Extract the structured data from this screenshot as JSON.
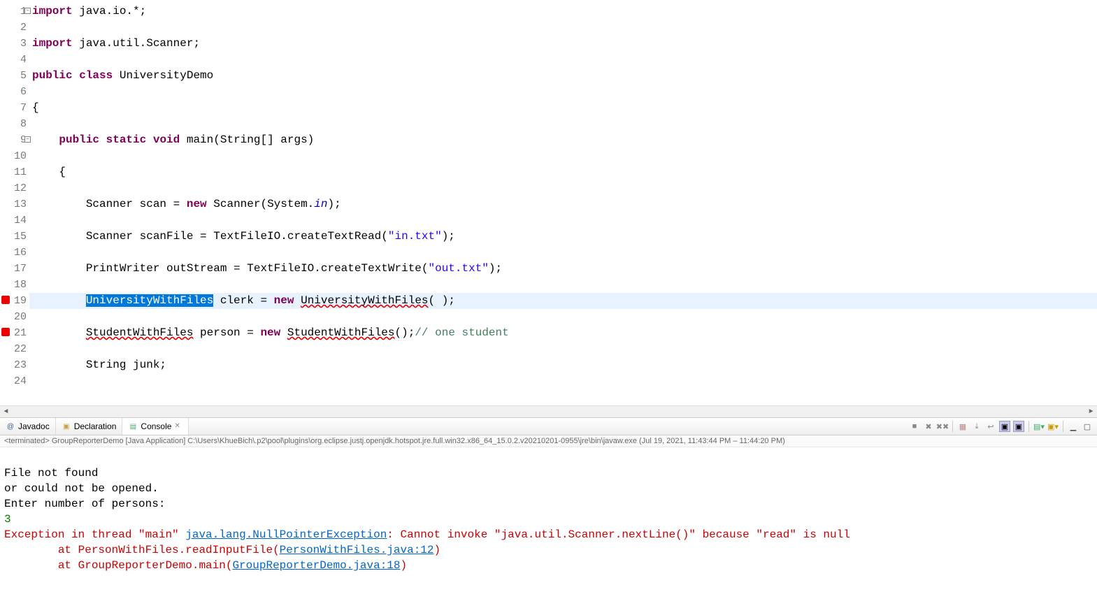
{
  "editor": {
    "lines": [
      {
        "n": 1,
        "collapse": true,
        "tokens": [
          {
            "t": "import",
            "c": "kw"
          },
          {
            "t": " java.io.*;"
          }
        ]
      },
      {
        "n": 2,
        "tokens": []
      },
      {
        "n": 3,
        "tokens": [
          {
            "t": "import",
            "c": "kw"
          },
          {
            "t": " java.util.Scanner;"
          }
        ]
      },
      {
        "n": 4,
        "tokens": []
      },
      {
        "n": 5,
        "tokens": [
          {
            "t": "public",
            "c": "kw"
          },
          {
            "t": " "
          },
          {
            "t": "class",
            "c": "kw"
          },
          {
            "t": " UniversityDemo"
          }
        ]
      },
      {
        "n": 6,
        "tokens": []
      },
      {
        "n": 7,
        "tokens": [
          {
            "t": "{"
          }
        ]
      },
      {
        "n": 8,
        "tokens": []
      },
      {
        "n": 9,
        "collapse": true,
        "tokens": [
          {
            "t": "    "
          },
          {
            "t": "public",
            "c": "kw"
          },
          {
            "t": " "
          },
          {
            "t": "static",
            "c": "kw"
          },
          {
            "t": " "
          },
          {
            "t": "void",
            "c": "kw"
          },
          {
            "t": " main(String[] args)"
          }
        ]
      },
      {
        "n": 10,
        "tokens": []
      },
      {
        "n": 11,
        "tokens": [
          {
            "t": "    {"
          }
        ]
      },
      {
        "n": 12,
        "tokens": []
      },
      {
        "n": 13,
        "tokens": [
          {
            "t": "        Scanner scan = "
          },
          {
            "t": "new",
            "c": "kw"
          },
          {
            "t": " Scanner(System."
          },
          {
            "t": "in",
            "c": "static-field"
          },
          {
            "t": ");"
          }
        ]
      },
      {
        "n": 14,
        "tokens": []
      },
      {
        "n": 15,
        "tokens": [
          {
            "t": "        Scanner scanFile = TextFileIO.createTextRead("
          },
          {
            "t": "\"in.txt\"",
            "c": "str"
          },
          {
            "t": ");"
          }
        ]
      },
      {
        "n": 16,
        "tokens": []
      },
      {
        "n": 17,
        "tokens": [
          {
            "t": "        PrintWriter outStream = TextFileIO.createTextWrite("
          },
          {
            "t": "\"out.txt\"",
            "c": "str"
          },
          {
            "t": ");"
          }
        ]
      },
      {
        "n": 18,
        "tokens": []
      },
      {
        "n": 19,
        "hl": true,
        "err": true,
        "tokens": [
          {
            "t": "        "
          },
          {
            "t": "UniversityWithFiles",
            "c": "selected"
          },
          {
            "t": " clerk = "
          },
          {
            "t": "new",
            "c": "kw"
          },
          {
            "t": " "
          },
          {
            "t": "UniversityWithFiles",
            "c": "err-underline"
          },
          {
            "t": "( );"
          }
        ]
      },
      {
        "n": 20,
        "tokens": []
      },
      {
        "n": 21,
        "err": true,
        "tokens": [
          {
            "t": "        "
          },
          {
            "t": "StudentWithFiles",
            "c": "err-underline"
          },
          {
            "t": " person = "
          },
          {
            "t": "new",
            "c": "kw"
          },
          {
            "t": " "
          },
          {
            "t": "StudentWithFiles",
            "c": "err-underline"
          },
          {
            "t": "();"
          },
          {
            "t": "// one student",
            "c": "comment"
          }
        ]
      },
      {
        "n": 22,
        "tokens": []
      },
      {
        "n": 23,
        "tokens": [
          {
            "t": "        String junk;"
          }
        ]
      },
      {
        "n": 24,
        "tokens": []
      }
    ]
  },
  "tabs": {
    "javadoc": "Javadoc",
    "declaration": "Declaration",
    "console": "Console"
  },
  "console": {
    "status": "<terminated> GroupReporterDemo [Java Application] C:\\Users\\KhueBich\\.p2\\pool\\plugins\\org.eclipse.justj.openjdk.hotspot.jre.full.win32.x86_64_15.0.2.v20210201-0955\\jre\\bin\\javaw.exe (Jul 19, 2021, 11:43:44 PM – 11:44:20 PM)",
    "out1": "File not found",
    "out2": "or could not be opened.",
    "out3": "Enter number of persons:",
    "input": "3",
    "err_prefix": "Exception in thread \"main\" ",
    "err_exception": "java.lang.NullPointerException",
    "err_msg": ": Cannot invoke \"java.util.Scanner.nextLine()\" because \"read\" is null",
    "trace1_prefix": "        at PersonWithFiles.readInputFile(",
    "trace1_link": "PersonWithFiles.java:12",
    "trace1_suffix": ")",
    "trace2_prefix": "        at GroupReporterDemo.main(",
    "trace2_link": "GroupReporterDemo.java:18",
    "trace2_suffix": ")"
  }
}
